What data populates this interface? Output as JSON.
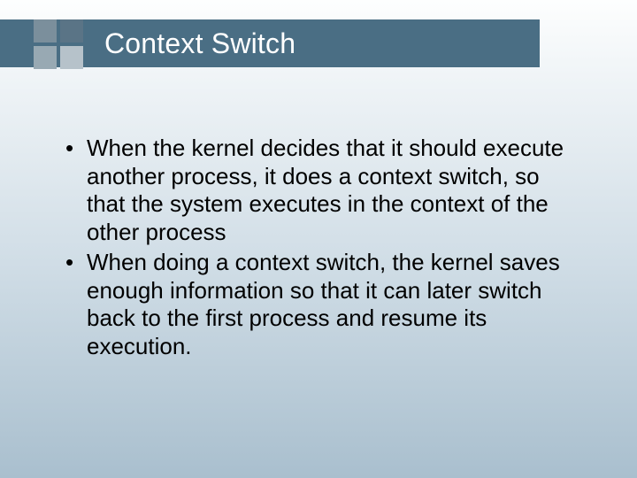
{
  "title": "Context Switch",
  "bullets": [
    "When the kernel decides that it should execute another process, it does a context switch, so that the system executes in the context of the other process",
    "When doing a context switch, the kernel saves enough information so that it can later switch back to the first process and resume its execution."
  ]
}
